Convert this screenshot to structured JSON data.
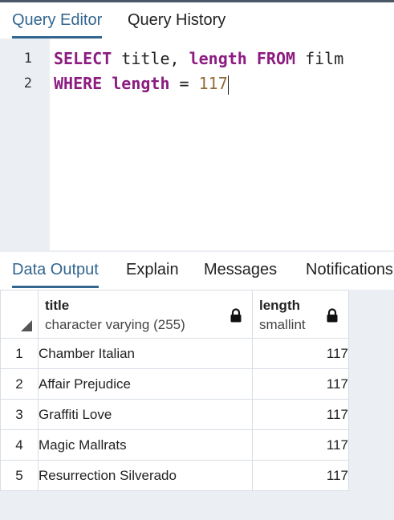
{
  "query_tabs": [
    {
      "label": "Query Editor",
      "active": true
    },
    {
      "label": "Query History",
      "active": false
    }
  ],
  "editor": {
    "line_numbers": [
      "1",
      "2"
    ],
    "line1": {
      "kw1": "SELECT",
      "t1": " title, ",
      "kw2": "length",
      "kw3": "FROM",
      "t2": " film"
    },
    "line2": {
      "kw1": "WHERE",
      "kw2": "length",
      "t1": " = ",
      "num": "117"
    }
  },
  "output_tabs": [
    {
      "label": "Data Output",
      "active": true
    },
    {
      "label": "Explain",
      "active": false
    },
    {
      "label": "Messages",
      "active": false
    },
    {
      "label": "Notifications",
      "active": false
    }
  ],
  "grid": {
    "columns": [
      {
        "name": "title",
        "type": "character varying (255)",
        "icon": "lock-icon"
      },
      {
        "name": "length",
        "type": "smallint",
        "icon": "lock-icon"
      }
    ],
    "rows": [
      {
        "num": "1",
        "title": "Chamber Italian",
        "length": "117"
      },
      {
        "num": "2",
        "title": "Affair Prejudice",
        "length": "117"
      },
      {
        "num": "3",
        "title": "Graffiti Love",
        "length": "117"
      },
      {
        "num": "4",
        "title": "Magic Mallrats",
        "length": "117"
      },
      {
        "num": "5",
        "title": "Resurrection Silverado",
        "length": "117"
      }
    ]
  },
  "colors": {
    "accent": "#326690",
    "keyword": "#8c1c80",
    "number": "#936a3a",
    "panel_bg": "#ebeef3"
  }
}
